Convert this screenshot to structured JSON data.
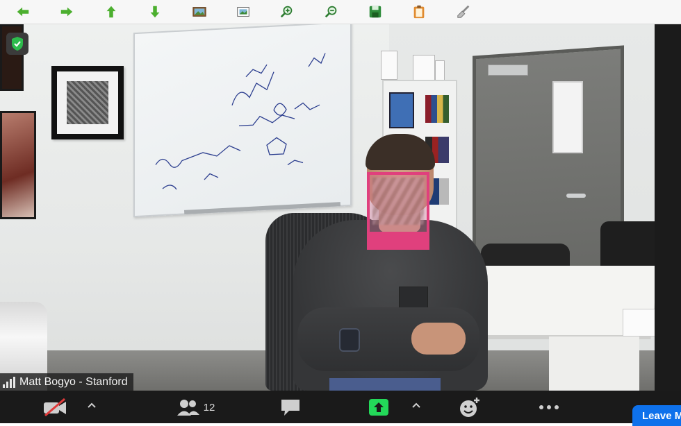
{
  "toolbar": {
    "buttons": [
      {
        "name": "back-arrow-icon",
        "color": "#4caf2f"
      },
      {
        "name": "forward-arrow-icon",
        "color": "#4caf2f"
      },
      {
        "name": "up-arrow-icon",
        "color": "#4caf2f"
      },
      {
        "name": "down-arrow-icon",
        "color": "#4caf2f"
      },
      {
        "name": "image-icon"
      },
      {
        "name": "fit-image-icon"
      },
      {
        "name": "zoom-in-icon"
      },
      {
        "name": "zoom-out-icon"
      },
      {
        "name": "save-icon"
      },
      {
        "name": "clipboard-icon"
      },
      {
        "name": "brush-icon"
      }
    ]
  },
  "video": {
    "participant_name": "Matt Bogyo - Stanford",
    "encryption_icon": "shield-check-icon",
    "face_highlight_color": "#e0407d"
  },
  "controls": {
    "video_icon": "video-off-icon",
    "participants_icon": "participants-icon",
    "participants_count": "12",
    "chat_icon": "chat-icon",
    "share_icon": "share-screen-icon",
    "share_color": "#23d959",
    "reactions_icon": "reactions-icon",
    "more_icon": "more-icon",
    "leave_label": "Leave M",
    "leave_color": "#0e71eb"
  }
}
